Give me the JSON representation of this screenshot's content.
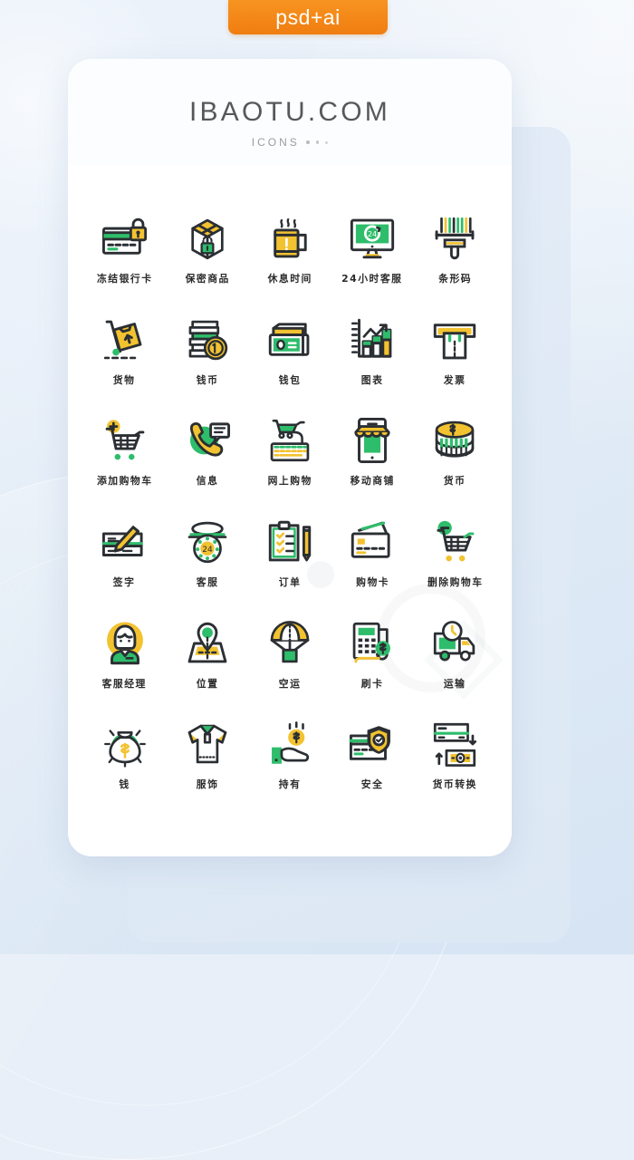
{
  "badge": {
    "label": "psd+ai",
    "color": "#f2801a"
  },
  "header": {
    "title": "IBAOTU.COM",
    "subtitle": "ICONS",
    "dots": 3
  },
  "palette": {
    "stroke": "#2b2f33",
    "green": "#2ebd6b",
    "yellow": "#f2c230",
    "white": "#ffffff",
    "card": "#ffffff",
    "card_back": "#e0eaf6",
    "background": "#e4edf7"
  },
  "grid": {
    "columns": 5,
    "rows": 6,
    "count": 30
  },
  "icons": [
    {
      "label": "冻结银行卡",
      "name": "frozen-bank-card"
    },
    {
      "label": "保密商品",
      "name": "confidential-package"
    },
    {
      "label": "休息时间",
      "name": "rest-time-mug"
    },
    {
      "label": "24小时客服",
      "name": "24h-customer-service-monitor"
    },
    {
      "label": "条形码",
      "name": "barcode-scanner"
    },
    {
      "label": "货物",
      "name": "goods-hand-truck"
    },
    {
      "label": "钱币",
      "name": "coins-stack"
    },
    {
      "label": "钱包",
      "name": "wallet-cash"
    },
    {
      "label": "图表",
      "name": "bar-chart-growth"
    },
    {
      "label": "发票",
      "name": "invoice-receipt-printer"
    },
    {
      "label": "添加购物车",
      "name": "add-to-cart"
    },
    {
      "label": "信息",
      "name": "phone-message"
    },
    {
      "label": "网上购物",
      "name": "online-shopping-keyboard"
    },
    {
      "label": "移动商铺",
      "name": "mobile-shop"
    },
    {
      "label": "货币",
      "name": "currency-coins-dollar"
    },
    {
      "label": "签字",
      "name": "signature-cheque-pen"
    },
    {
      "label": "客服",
      "name": "customer-service-rotary-phone"
    },
    {
      "label": "订单",
      "name": "order-clipboard-pencil"
    },
    {
      "label": "购物卡",
      "name": "shopping-card"
    },
    {
      "label": "删除购物车",
      "name": "remove-from-cart"
    },
    {
      "label": "客服经理",
      "name": "service-manager-avatar"
    },
    {
      "label": "位置",
      "name": "location-map-pin"
    },
    {
      "label": "空运",
      "name": "air-freight-parachute"
    },
    {
      "label": "刷卡",
      "name": "card-swipe-pos"
    },
    {
      "label": "运输",
      "name": "transport-delivery-truck"
    },
    {
      "label": "钱",
      "name": "money-bag"
    },
    {
      "label": "服饰",
      "name": "clothing-polo-shirt"
    },
    {
      "label": "持有",
      "name": "hold-hand-coin"
    },
    {
      "label": "安全",
      "name": "security-card-shield"
    },
    {
      "label": "货币转换",
      "name": "currency-exchange"
    }
  ]
}
